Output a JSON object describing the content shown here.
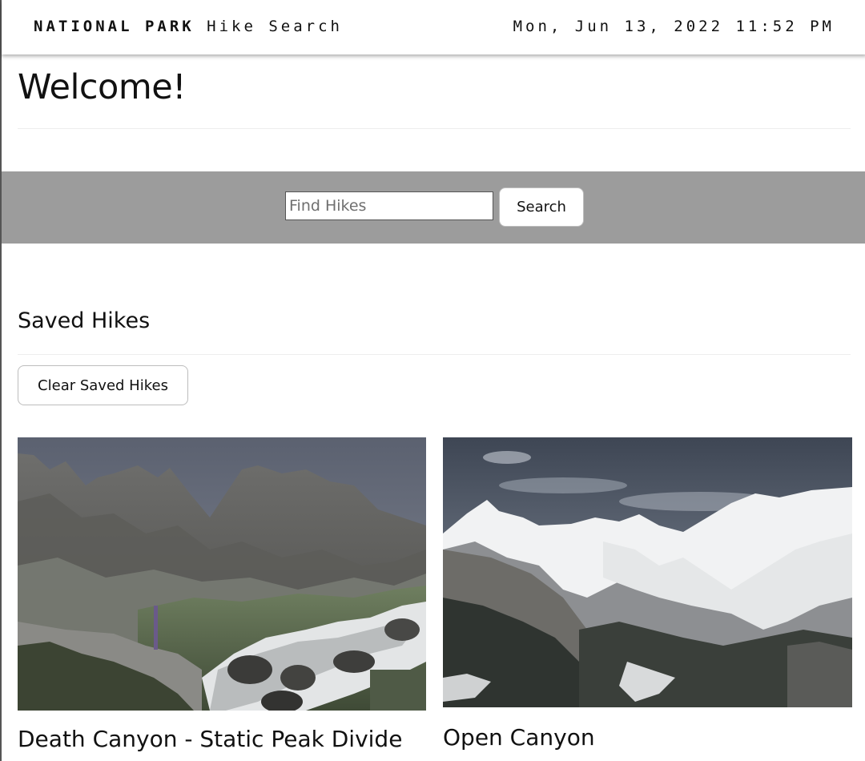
{
  "header": {
    "brand_bold": "NATIONAL PARK",
    "brand_light": "Hike Search",
    "datetime": "Mon, Jun 13, 2022 11:52 PM"
  },
  "welcome": {
    "title": "Welcome!"
  },
  "search": {
    "placeholder": "Find Hikes",
    "value": "",
    "button_label": "Search"
  },
  "saved": {
    "heading": "Saved Hikes",
    "clear_label": "Clear Saved Hikes",
    "hikes": [
      {
        "title": "Death Canyon - Static Peak Divide",
        "image_alt": "Rocky canyon with waterfall and wildflowers"
      },
      {
        "title": "Open Canyon",
        "image_alt": "Snow-covered mountain range under cloudy sky"
      }
    ]
  },
  "colors": {
    "search_band": "#9c9c9c",
    "navbar": "#ffffff",
    "text": "#111111"
  }
}
